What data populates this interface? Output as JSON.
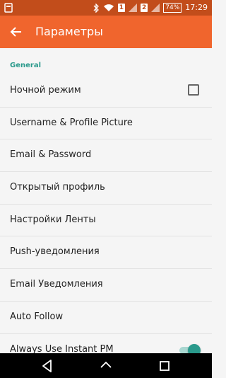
{
  "status_bar": {
    "sim1": "1",
    "sim2": "2",
    "battery": "74",
    "time": "17:29"
  },
  "toolbar": {
    "title": "Параметры",
    "back_icon": "arrow-back-icon"
  },
  "settings": {
    "section_header": "General",
    "items": [
      {
        "label": "Ночной режим",
        "control": "checkbox",
        "checked": false
      },
      {
        "label": "Username & Profile Picture"
      },
      {
        "label": "Email & Password"
      },
      {
        "label": "Открытый профиль"
      },
      {
        "label": "Настройки Ленты"
      },
      {
        "label": "Push-уведомления"
      },
      {
        "label": "Email Уведомления"
      },
      {
        "label": "Auto Follow"
      },
      {
        "label": "Always Use Instant PM",
        "control": "switch",
        "checked": true
      }
    ]
  },
  "colors": {
    "toolbar": "#f0652d",
    "status_bar": "#c24d1b",
    "accent": "#2a9a8c"
  },
  "nav_bar": {
    "icons": [
      "back-triangle-icon",
      "home-circle-icon",
      "recents-square-icon"
    ]
  }
}
